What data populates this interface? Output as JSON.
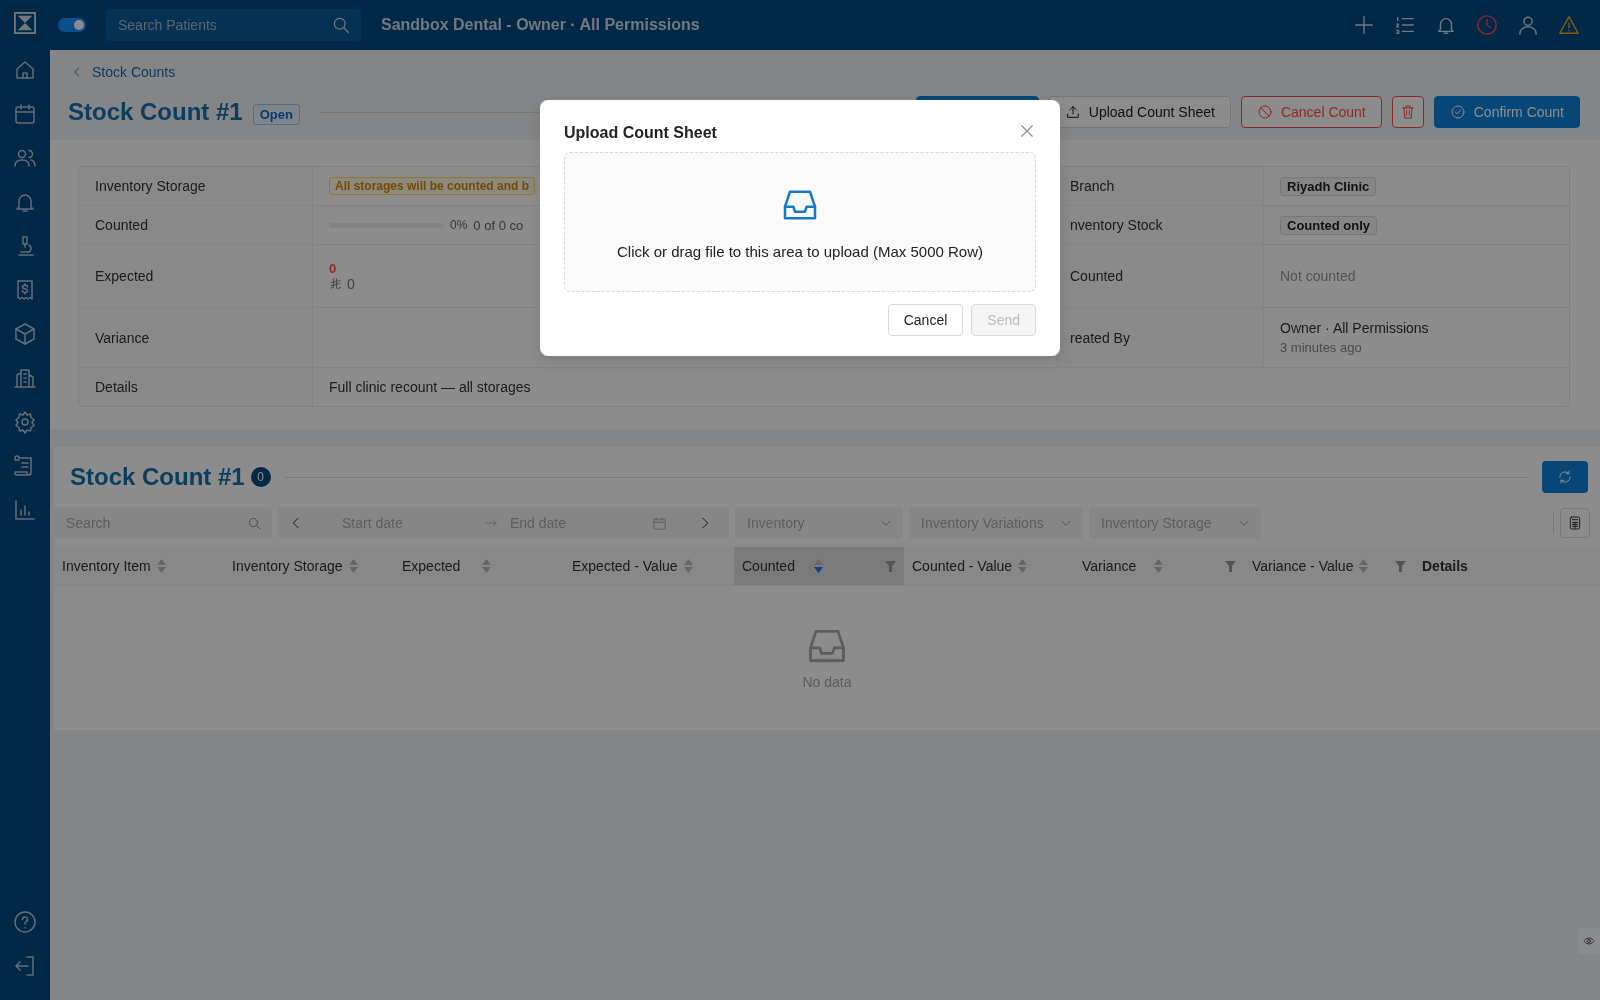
{
  "topbar": {
    "toggle_on": true,
    "search": {
      "placeholder": "Search Patients"
    },
    "title": "Sandbox Dental - Owner · All Permissions"
  },
  "breadcrumb": "Stock Counts",
  "header": {
    "title": "Stock Count #1",
    "status": "Open",
    "buttons": [
      {
        "kind": "primary-blank"
      },
      {
        "kind": "upload",
        "label": "Upload Count Sheet"
      },
      {
        "kind": "danger",
        "label": "Cancel Count"
      },
      {
        "kind": "delete"
      },
      {
        "kind": "confirm",
        "label": "Confirm Count"
      }
    ]
  },
  "info": {
    "inventory_storage": {
      "label": "Inventory Storage",
      "tag": "All storages will be counted and b"
    },
    "counted": {
      "label": "Counted",
      "level": 0,
      "percent": "0%",
      "summary": "0 of 0 co"
    },
    "expected": {
      "label": "Expected",
      "quantity": "0",
      "value": "0"
    },
    "variance": {
      "label": "Variance"
    },
    "details": {
      "label": "Details",
      "text": "Full clinic recount — all storages"
    },
    "branch": {
      "label": "Branch",
      "tag": "Riyadh Clinic"
    },
    "inventory_stock": {
      "label": "nventory Stock",
      "tag": "Counted only"
    },
    "counted_status": {
      "label": "Counted",
      "text": "Not counted"
    },
    "created_by": {
      "label": "reated By",
      "name": "Owner · All Permissions",
      "time": "3 minutes ago"
    }
  },
  "list": {
    "title": "Stock Count #1",
    "count": "0",
    "filters": {
      "search": {
        "placeholder": "Search"
      },
      "start": {
        "placeholder": "Start date"
      },
      "end": {
        "placeholder": "End date"
      },
      "selects": [
        {
          "placeholder": "Inventory"
        },
        {
          "placeholder": "Inventory Variations"
        },
        {
          "placeholder": "Inventory Storage"
        }
      ]
    },
    "columns": [
      {
        "label": "Inventory Item",
        "sortable": true,
        "sorted": false,
        "filter": false
      },
      {
        "label": "Inventory Storage",
        "sortable": true,
        "sorted": false,
        "filter": false
      },
      {
        "label": "Expected",
        "sortable": true,
        "sorted": false,
        "filter": false
      },
      {
        "label": "Expected - Value",
        "sortable": true,
        "sorted": false,
        "filter": false
      },
      {
        "label": "Counted",
        "sortable": true,
        "sorted": true,
        "filter": true
      },
      {
        "label": "Counted - Value",
        "sortable": true,
        "sorted": false,
        "filter": false
      },
      {
        "label": "Variance",
        "sortable": true,
        "sorted": false,
        "filter": true
      },
      {
        "label": "Variance - Value",
        "sortable": true,
        "sorted": false,
        "filter": true
      },
      {
        "label": "Details",
        "sortable": false,
        "sorted": false,
        "filter": false
      }
    ],
    "empty": "No data"
  },
  "modal": {
    "title": "Upload Count Sheet",
    "dropzone": "Click or drag file to this area to upload (Max 5000 Row)",
    "buttons": [
      {
        "label": "Cancel",
        "disabled": false
      },
      {
        "label": "Send",
        "disabled": true
      }
    ]
  }
}
